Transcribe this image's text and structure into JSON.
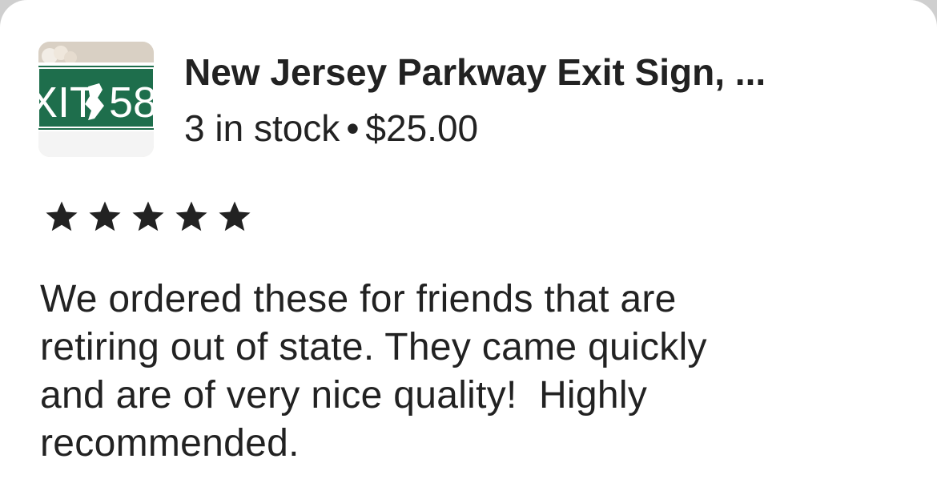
{
  "listing": {
    "thumbnail": {
      "icon": "product-thumbnail-image",
      "sign_text_left": "XIT",
      "sign_text_right": "58",
      "sign_color": "#1e6e4c"
    },
    "title": "New Jersey Parkway Exit Sign, ...",
    "stock": "3 in stock",
    "separator": "•",
    "price": "$25.00"
  },
  "review": {
    "rating": 5,
    "rating_max": 5,
    "star_icon": "star-filled-icon",
    "star_color": "#222222",
    "text": "We ordered these for friends that are\nretiring out of state. They came quickly\nand are of very nice quality!  Highly\nrecommended."
  }
}
